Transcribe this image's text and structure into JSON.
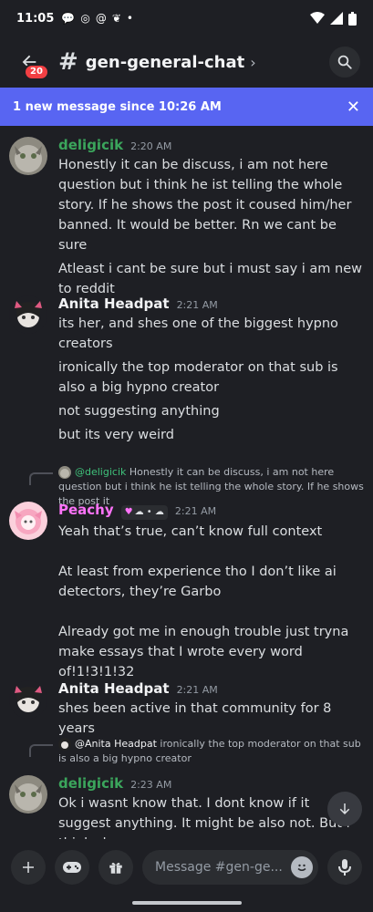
{
  "status": {
    "time": "11:05"
  },
  "header": {
    "badge": "20",
    "channel": "gen-general-chat"
  },
  "banner": {
    "text": "1 new message since 10:26 AM"
  },
  "colors": {
    "deligicik": "#3ba55c",
    "anita": "#f2f3f5",
    "peachy": "#ff73fa",
    "accent": "#5865f2"
  },
  "messages": [
    {
      "user": "deligicik",
      "time": "2:20 AM",
      "lines": [
        "Honestly it can be discuss, i am not here question but i think he ist telling the whole story. If he shows the post it coused him/her banned. It would be better. Rn we cant be sure",
        "Atleast i cant be sure but i must say i am new to reddit"
      ]
    },
    {
      "user": "Anita Headpat",
      "time": "2:21 AM",
      "lines": [
        "its her, and shes one of the biggest hypno creators",
        "ironically the top moderator on that sub is also a big hypno creator",
        "not suggesting anything",
        "but its very weird"
      ]
    },
    {
      "reply": {
        "name": "@deligicik",
        "text": "Honestly it can be discuss, i am not here question but i think he ist telling the whole story. If he shows the post it"
      },
      "user": "Peachy",
      "tag": "☁︎ • ☁︎",
      "time": "2:21 AM",
      "lines": [
        "Yeah that’s true, can’t know full context",
        "At least from experience tho I don’t like ai detectors, they’re Garbo",
        "Already got me in enough trouble just tryna make essays that I wrote every word of!1!3!1!32"
      ]
    },
    {
      "user": "Anita Headpat",
      "time": "2:21 AM",
      "lines": [
        "shes been active in that community for 8 years"
      ]
    },
    {
      "reply": {
        "name": "@Anita Headpat",
        "text": "ironically the top moderator on that sub is also a big hypno creator"
      },
      "user": "deligicik",
      "time": "2:23 AM",
      "lines": [
        "Ok i wasnt know that. I dont know if it suggest anything. It might be also not. But i think she"
      ]
    }
  ],
  "composer": {
    "placeholder": "Message #gen-ge..."
  }
}
